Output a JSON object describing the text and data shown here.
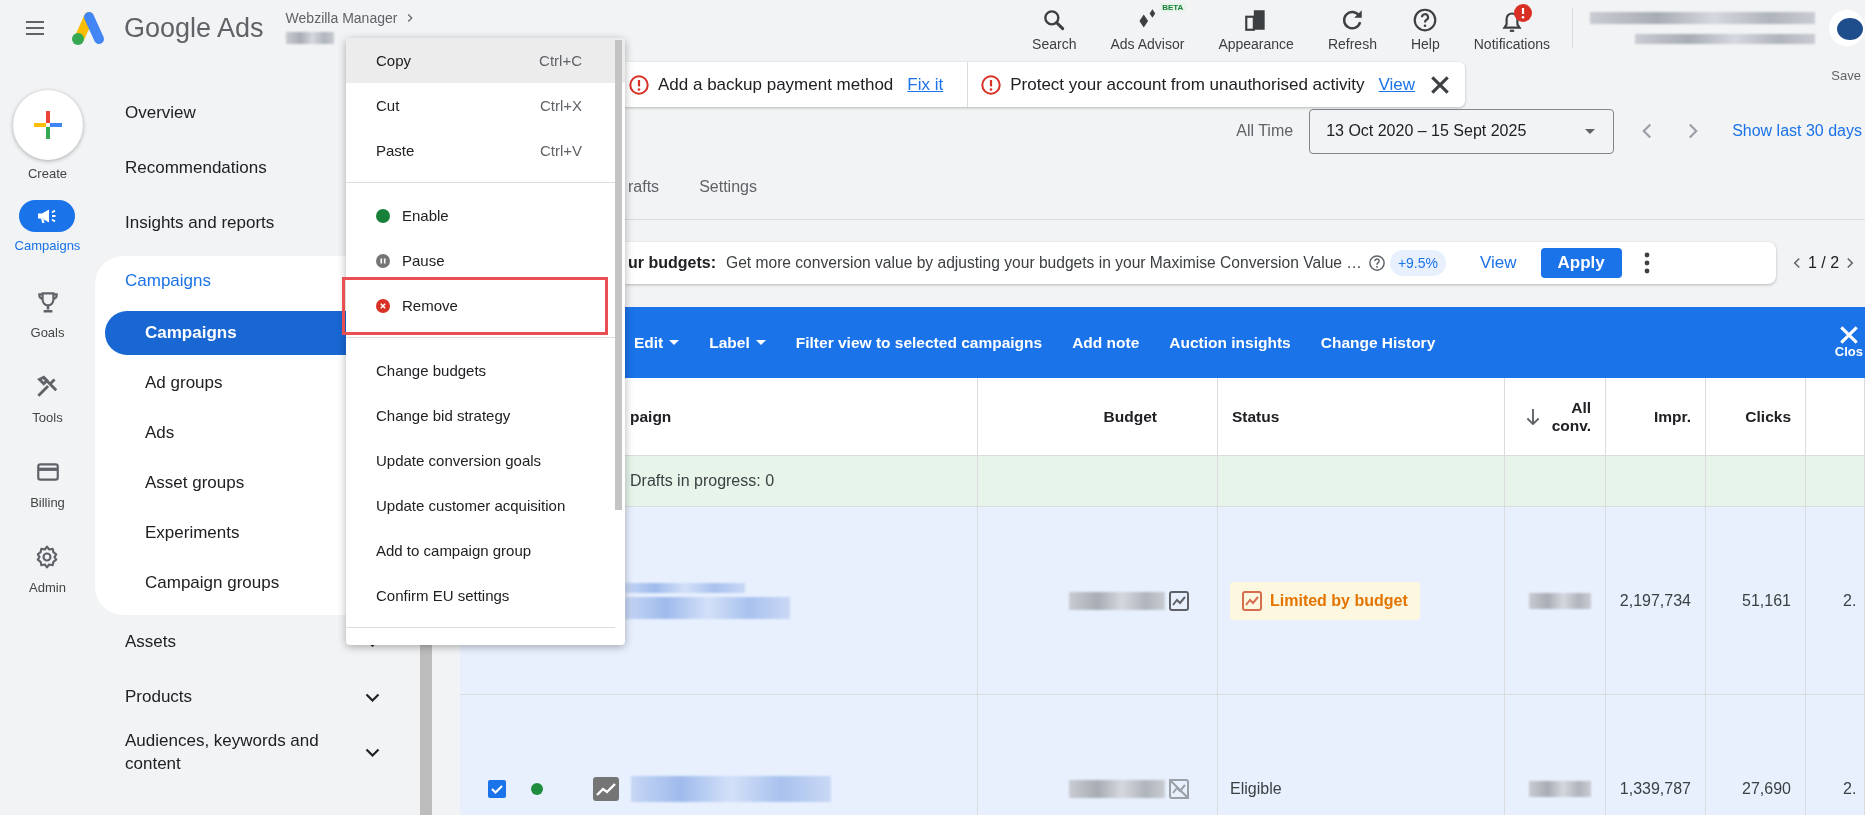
{
  "top_bar": {
    "product_name": "Google Ads",
    "account_name": "Webzilla Manager",
    "actions": [
      {
        "kind": "search",
        "label": "Search",
        "alert": false
      },
      {
        "kind": "advisor",
        "label": "Ads Advisor",
        "badge": "BETA",
        "alert": false
      },
      {
        "kind": "appearance",
        "label": "Appearance",
        "alert": false
      },
      {
        "kind": "refresh",
        "label": "Refresh",
        "alert": false
      },
      {
        "kind": "help",
        "label": "Help",
        "alert": false
      },
      {
        "kind": "notifications",
        "label": "Notifications",
        "alert": true
      }
    ],
    "save_label": "Save"
  },
  "rail": {
    "create_label": "Create",
    "items": [
      {
        "kind": "campaigns",
        "label": "Campaigns",
        "selected": true
      },
      {
        "kind": "goals",
        "label": "Goals",
        "selected": false
      },
      {
        "kind": "tools",
        "label": "Tools",
        "selected": false
      },
      {
        "kind": "billing",
        "label": "Billing",
        "selected": false
      },
      {
        "kind": "admin",
        "label": "Admin",
        "selected": false
      }
    ]
  },
  "nav": {
    "items": [
      {
        "kind": "link",
        "label": "Overview"
      },
      {
        "kind": "link",
        "label": "Recommendations"
      },
      {
        "kind": "link",
        "label": "Insights and reports"
      },
      {
        "kind": "group",
        "label": "Campaigns",
        "expanded": true,
        "children": [
          {
            "label": "Campaigns",
            "selected": true
          },
          {
            "label": "Ad groups",
            "selected": false
          },
          {
            "label": "Ads",
            "selected": false
          },
          {
            "label": "Asset groups",
            "selected": false
          },
          {
            "label": "Experiments",
            "selected": false
          },
          {
            "label": "Campaign groups",
            "selected": false
          }
        ]
      },
      {
        "kind": "group",
        "label": "Assets",
        "expanded": false
      },
      {
        "kind": "group",
        "label": "Products",
        "expanded": false
      },
      {
        "kind": "group",
        "label": "Audiences, keywords and content",
        "expanded": false
      }
    ]
  },
  "context_menu": {
    "items": [
      {
        "kind": "action",
        "label": "Copy",
        "shortcut": "Ctrl+C",
        "highlighted": true,
        "annotated": false
      },
      {
        "kind": "action",
        "label": "Cut",
        "shortcut": "Ctrl+X",
        "highlighted": false,
        "annotated": false
      },
      {
        "kind": "action",
        "label": "Paste",
        "shortcut": "Ctrl+V",
        "highlighted": false,
        "annotated": false
      },
      {
        "kind": "divider"
      },
      {
        "kind": "enable",
        "label": "Enable",
        "highlighted": false,
        "annotated": false
      },
      {
        "kind": "pause",
        "label": "Pause",
        "highlighted": false,
        "annotated": false
      },
      {
        "kind": "remove",
        "label": "Remove",
        "highlighted": false,
        "annotated": true
      },
      {
        "kind": "divider"
      },
      {
        "kind": "action",
        "label": "Change budgets",
        "highlighted": false,
        "annotated": false
      },
      {
        "kind": "action",
        "label": "Change bid strategy",
        "highlighted": false,
        "annotated": false
      },
      {
        "kind": "action",
        "label": "Update conversion goals",
        "highlighted": false,
        "annotated": false
      },
      {
        "kind": "action",
        "label": "Update customer acquisition",
        "highlighted": false,
        "annotated": false
      },
      {
        "kind": "action",
        "label": "Add to campaign group",
        "highlighted": false,
        "annotated": false
      },
      {
        "kind": "action",
        "label": "Confirm EU settings",
        "highlighted": false,
        "annotated": false
      },
      {
        "kind": "divider"
      }
    ]
  },
  "alerts": [
    {
      "message": "Add a backup payment method",
      "action": "Fix it"
    },
    {
      "message": "Protect your account from unauthorised activity",
      "action": "View",
      "dismissible": true
    }
  ],
  "date_range": {
    "label": "All Time",
    "value": "13 Oct 2020 – 15 Sept 2025",
    "quick_link": "Show last 30 days"
  },
  "tabs": [
    {
      "label": "rafts"
    },
    {
      "label": "Settings"
    }
  ],
  "recommendation": {
    "title": "ur budgets:",
    "text": "Get more conversion value by adjusting your budgets in your Maximise Conversion Value …",
    "uplift": "+9.5%",
    "view": "View",
    "apply": "Apply",
    "pager": "1 / 2"
  },
  "action_bar": {
    "items": [
      {
        "label": "Edit",
        "dropdown": true
      },
      {
        "label": "Label",
        "dropdown": true
      },
      {
        "label": "Filter view to selected campaigns",
        "dropdown": false
      },
      {
        "label": "Add note",
        "dropdown": false
      },
      {
        "label": "Auction insights",
        "dropdown": false
      },
      {
        "label": "Change History",
        "dropdown": false
      }
    ],
    "close_label": "Clos"
  },
  "table": {
    "columns": [
      {
        "label": "paign",
        "numeric": false,
        "sorted": false
      },
      {
        "label": "Budget",
        "numeric": true,
        "sorted": false
      },
      {
        "label": "Status",
        "numeric": false,
        "sorted": false
      },
      {
        "label": "All conv.",
        "numeric": true,
        "sorted": true
      },
      {
        "label": "Impr.",
        "numeric": true,
        "sorted": false
      },
      {
        "label": "Clicks",
        "numeric": true,
        "sorted": false
      }
    ],
    "drafts_row": "Drafts in progress: 0",
    "rows": [
      {
        "selected": true,
        "budget_chart": true,
        "status": {
          "kind": "chip",
          "text": "Limited by budget"
        },
        "impressions": "2,197,734",
        "clicks": "51,161",
        "column_7": "2."
      },
      {
        "selected": true,
        "checked": true,
        "color": "#1e8e3e",
        "budget_chart": false,
        "status": {
          "kind": "plain",
          "text": "Eligible"
        },
        "impressions": "1,339,787",
        "clicks": "27,690",
        "column_7": "2."
      }
    ]
  }
}
